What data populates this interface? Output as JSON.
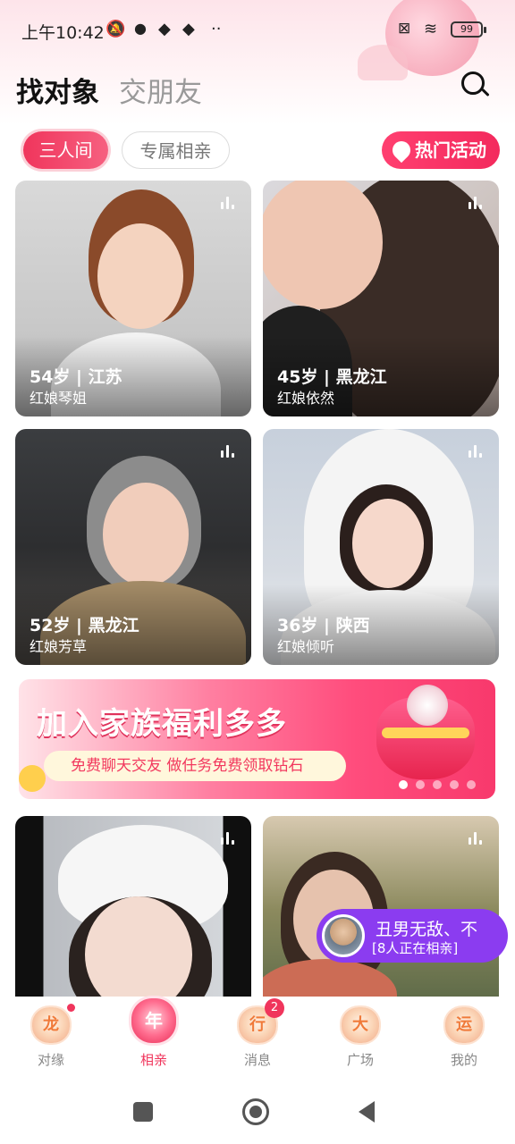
{
  "status_bar": {
    "time": "上午10:42",
    "battery": "99"
  },
  "header": {
    "tab_active": "找对象",
    "tab_inactive": "交朋友",
    "search_icon": "search-icon"
  },
  "chips": {
    "sanren": "三人间",
    "zhuanshu": "专属相亲",
    "hot": "热门活动"
  },
  "cards": [
    {
      "age_location": "54岁 | 江苏",
      "matchmaker": "红娘琴姐"
    },
    {
      "age_location": "45岁 | 黑龙江",
      "matchmaker": "红娘依然"
    },
    {
      "age_location": "52岁 | 黑龙江",
      "matchmaker": "红娘芳草"
    },
    {
      "age_location": "36岁 | 陕西",
      "matchmaker": "红娘倾听"
    }
  ],
  "banner": {
    "title": "加入家族福利多多",
    "subtitle": "免费聊天交友 做任务免费领取钻石",
    "page_count": 5,
    "active_page": 0
  },
  "live": {
    "name": "丑男无敌、不",
    "count": "[8人正在相亲]"
  },
  "bottom_nav": [
    {
      "icon": "龙",
      "label": "对缘",
      "dot": true,
      "badge": ""
    },
    {
      "icon": "年",
      "label": "相亲",
      "dot": false,
      "badge": ""
    },
    {
      "icon": "行",
      "label": "消息",
      "dot": false,
      "badge": "2"
    },
    {
      "icon": "大",
      "label": "广场",
      "dot": false,
      "badge": ""
    },
    {
      "icon": "运",
      "label": "我的",
      "dot": false,
      "badge": ""
    }
  ],
  "colors": {
    "accent": "#f0355c",
    "live_pill": "#8b3cf0"
  }
}
